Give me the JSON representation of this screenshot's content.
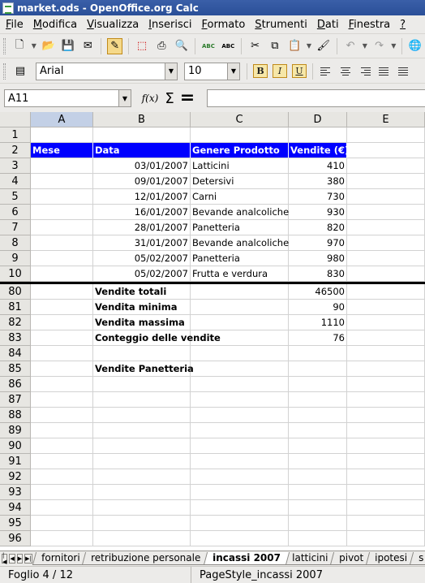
{
  "window": {
    "title": "market.ods - OpenOffice.org Calc"
  },
  "menu": [
    {
      "label": "File",
      "u": "F",
      "rest": "ile"
    },
    {
      "label": "Modifica",
      "u": "M",
      "rest": "odifica"
    },
    {
      "label": "Visualizza",
      "u": "V",
      "rest": "isualizza"
    },
    {
      "label": "Inserisci",
      "u": "I",
      "rest": "nserisci"
    },
    {
      "label": "Formato",
      "u": "F",
      "rest": "ormato"
    },
    {
      "label": "Strumenti",
      "u": "S",
      "rest": "trumenti"
    },
    {
      "label": "Dati",
      "u": "D",
      "rest": "ati"
    },
    {
      "label": "Finestra",
      "u": "F",
      "rest": "inestra"
    },
    {
      "label": "?",
      "u": "?",
      "rest": ""
    }
  ],
  "formatting": {
    "font_name": "Arial",
    "font_size": "10",
    "bold": "B",
    "italic": "I",
    "underline": "U"
  },
  "formula_bar": {
    "name_box": "A11",
    "fx": "f(x)",
    "sigma": "Σ",
    "equals": "=",
    "content": ""
  },
  "columns": [
    {
      "label": "A",
      "selected": true
    },
    {
      "label": "B",
      "selected": false
    },
    {
      "label": "C",
      "selected": false
    },
    {
      "label": "D",
      "selected": false
    },
    {
      "label": "E",
      "selected": false
    }
  ],
  "rows": [
    {
      "num": "1",
      "cells": [
        "",
        "",
        "",
        ""
      ]
    },
    {
      "num": "2",
      "header": true,
      "cells": [
        "Mese",
        "Data",
        "Genere Prodotto",
        "Vendite (€)"
      ]
    },
    {
      "num": "3",
      "cells": [
        "",
        "03/01/2007",
        "Latticini",
        "410"
      ]
    },
    {
      "num": "4",
      "cells": [
        "",
        "09/01/2007",
        "Detersivi",
        "380"
      ]
    },
    {
      "num": "5",
      "cells": [
        "",
        "12/01/2007",
        "Carni",
        "730"
      ]
    },
    {
      "num": "6",
      "cells": [
        "",
        "16/01/2007",
        "Bevande analcoliche",
        "930"
      ]
    },
    {
      "num": "7",
      "cells": [
        "",
        "28/01/2007",
        "Panetteria",
        "820"
      ]
    },
    {
      "num": "8",
      "cells": [
        "",
        "31/01/2007",
        "Bevande analcoliche",
        "970"
      ]
    },
    {
      "num": "9",
      "cells": [
        "",
        "05/02/2007",
        "Panetteria",
        "980"
      ]
    },
    {
      "num": "10",
      "cells": [
        "",
        "05/02/2007",
        "Frutta e verdura",
        "830"
      ]
    },
    {
      "num": "80",
      "summary": true,
      "cells": [
        "",
        "Vendite totali",
        "",
        "46500"
      ]
    },
    {
      "num": "81",
      "summary": true,
      "cells": [
        "",
        "Vendita minima",
        "",
        "90"
      ]
    },
    {
      "num": "82",
      "summary": true,
      "cells": [
        "",
        "Vendita massima",
        "",
        "1110"
      ]
    },
    {
      "num": "83",
      "summary": true,
      "cells": [
        "",
        "Conteggio delle vendite",
        "",
        "76"
      ]
    },
    {
      "num": "84",
      "cells": [
        "",
        "",
        "",
        ""
      ]
    },
    {
      "num": "85",
      "summary": true,
      "cells": [
        "",
        "Vendite Panetteria",
        "",
        ""
      ]
    },
    {
      "num": "86",
      "cells": [
        "",
        "",
        "",
        ""
      ]
    },
    {
      "num": "87",
      "cells": [
        "",
        "",
        "",
        ""
      ]
    },
    {
      "num": "88",
      "cells": [
        "",
        "",
        "",
        ""
      ]
    },
    {
      "num": "89",
      "cells": [
        "",
        "",
        "",
        ""
      ]
    },
    {
      "num": "90",
      "cells": [
        "",
        "",
        "",
        ""
      ]
    },
    {
      "num": "91",
      "cells": [
        "",
        "",
        "",
        ""
      ]
    },
    {
      "num": "92",
      "cells": [
        "",
        "",
        "",
        ""
      ]
    },
    {
      "num": "93",
      "cells": [
        "",
        "",
        "",
        ""
      ]
    },
    {
      "num": "94",
      "cells": [
        "",
        "",
        "",
        ""
      ]
    },
    {
      "num": "95",
      "cells": [
        "",
        "",
        "",
        ""
      ]
    },
    {
      "num": "96",
      "cells": [
        "",
        "",
        "",
        ""
      ]
    }
  ],
  "sheet_tabs": [
    {
      "label": "fornitori",
      "active": false
    },
    {
      "label": "retribuzione personale",
      "active": false
    },
    {
      "label": "incassi 2007",
      "active": true
    },
    {
      "label": "latticini",
      "active": false
    },
    {
      "label": "pivot",
      "active": false
    },
    {
      "label": "ipotesi",
      "active": false
    },
    {
      "label": "s",
      "active": false
    }
  ],
  "status": {
    "sheet": "Foglio 4 / 12",
    "page_style": "PageStyle_incassi 2007"
  },
  "colors": {
    "header_fill": "#0000ff",
    "header_text": "#ffffff",
    "titlebar": "#3a5fa8"
  }
}
